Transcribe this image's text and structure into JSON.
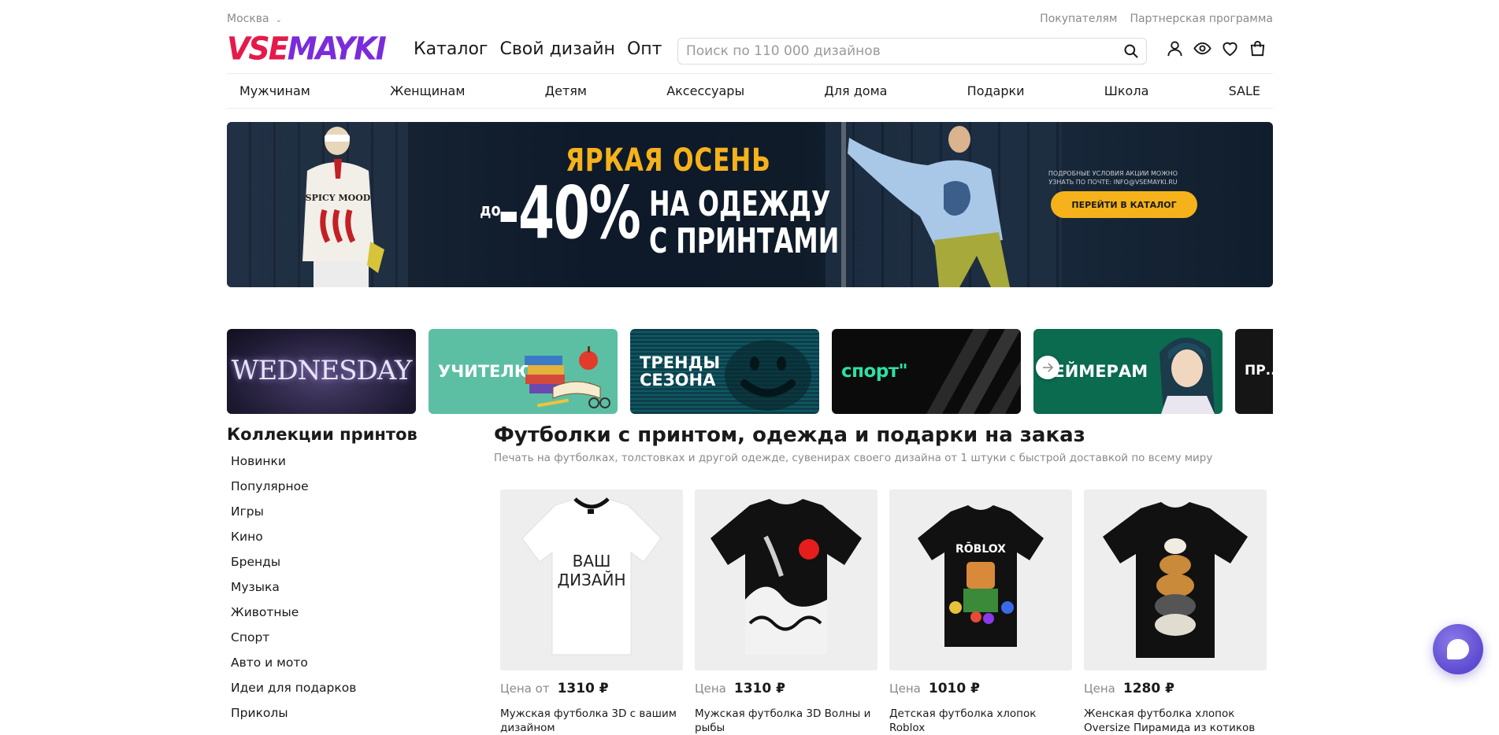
{
  "topbar": {
    "city": "Москва",
    "links": [
      "Покупателям",
      "Партнерская программа"
    ]
  },
  "header": {
    "logo": {
      "part1": "VSE",
      "part2": "MAYKI"
    },
    "nav": [
      "Каталог",
      "Свой дизайн",
      "Опт"
    ],
    "search_placeholder": "Поиск по 110 000 дизайнов",
    "icons": [
      "user-icon",
      "eye-icon",
      "heart-icon",
      "cart-icon"
    ]
  },
  "categories": [
    "Мужчинам",
    "Женщинам",
    "Детям",
    "Аксессуары",
    "Для дома",
    "Подарки",
    "Школа",
    "SALE"
  ],
  "banner": {
    "title": "ЯРКАЯ ОСЕНЬ",
    "upto": "до",
    "percent": "-40%",
    "line1": "НА ОДЕЖДУ",
    "line2": "С ПРИНТАМИ",
    "note": "ПОДРОБНЫЕ УСЛОВИЯ АКЦИИ МОЖНО УЗНАТЬ ПО ПОЧТЕ: INFO@VSEMAYKI.RU",
    "button": "ПЕРЕЙТИ В КАТАЛОГ",
    "accent": "#f5b21b",
    "sweatshirt_print": "SPICY MOOD"
  },
  "collections": [
    {
      "label": "WEDNESDAY"
    },
    {
      "label": "УЧИТЕЛЮ"
    },
    {
      "label": "ТРЕНДЫ СЕЗОНА"
    },
    {
      "label": "спорт\""
    },
    {
      "label": "ГЕЙМЕРАМ"
    },
    {
      "label": "ПР... НЕ..."
    }
  ],
  "sidebar": {
    "title": "Коллекции принтов",
    "items": [
      "Новинки",
      "Популярное",
      "Игры",
      "Кино",
      "Бренды",
      "Музыка",
      "Животные",
      "Спорт",
      "Авто и мото",
      "Идеи для подарков",
      "Приколы"
    ]
  },
  "main": {
    "title": "Футболки с принтом, одежда и подарки на заказ",
    "subtitle": "Печать на футболках, толстовках и другой одежде, сувенирах своего дизайна от 1 штуки с быстрой доставкой по всему миру"
  },
  "products": [
    {
      "price_label": "Цена от",
      "price": "1310 ₽",
      "name": "Мужская футболка 3D с вашим дизайном",
      "print": "ВАШ ДИЗАЙН"
    },
    {
      "price_label": "Цена",
      "price": "1310 ₽",
      "name": "Мужская футболка 3D Волны и рыбы"
    },
    {
      "price_label": "Цена",
      "price": "1010 ₽",
      "name": "Детская футболка хлопок Roblox",
      "print": "RŌBLOX"
    },
    {
      "price_label": "Цена",
      "price": "1280 ₽",
      "name": "Женская футболка хлопок Oversize Пирамида из котиков"
    }
  ],
  "colors": {
    "brand_red": "#e6194b",
    "brand_purple": "#7b2bdb",
    "chat": "#5d4bd1"
  }
}
